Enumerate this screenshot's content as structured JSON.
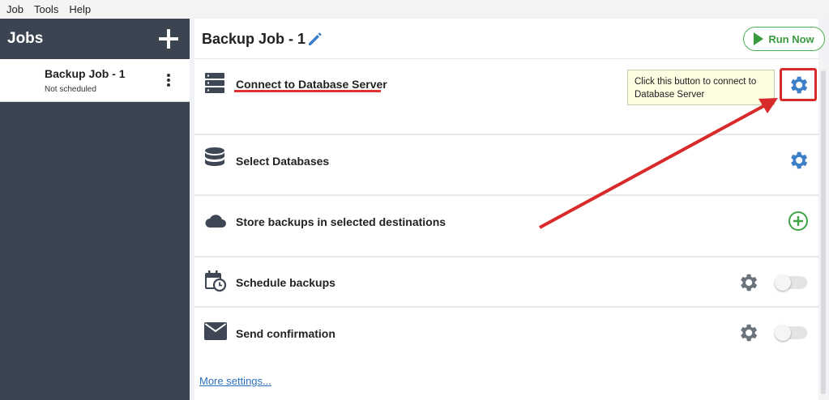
{
  "menubar": {
    "items": [
      "Job",
      "Tools",
      "Help"
    ]
  },
  "sidebar": {
    "title": "Jobs",
    "add_icon": "plus-icon",
    "jobs": [
      {
        "name": "Backup Job - 1",
        "status": "Not scheduled"
      }
    ]
  },
  "header": {
    "title": "Backup Job - 1",
    "run_label": "Run Now"
  },
  "steps": [
    {
      "label": "Connect to Database Server",
      "icon": "server-icon",
      "action_icon": "gear-icon"
    },
    {
      "label": "Select Databases",
      "icon": "database-icon",
      "action_icon": "gear-icon"
    },
    {
      "label": "Store backups in selected destinations",
      "icon": "cloud-icon",
      "action_icon": "add-circle-icon"
    },
    {
      "label": "Schedule backups",
      "icon": "calendar-clock-icon",
      "action_icon": "gear-icon",
      "toggle": false
    },
    {
      "label": "Send confirmation",
      "icon": "envelope-icon",
      "action_icon": "gear-icon",
      "toggle": false
    }
  ],
  "tooltip": {
    "text": "Click this button to connect to Database Server"
  },
  "footer": {
    "more_settings": "More settings..."
  },
  "colors": {
    "accent_blue": "#3d7fc9",
    "run_green": "#3a9a3f",
    "annotation_red": "#d82a2a",
    "sidebar_bg": "#3b4552"
  }
}
